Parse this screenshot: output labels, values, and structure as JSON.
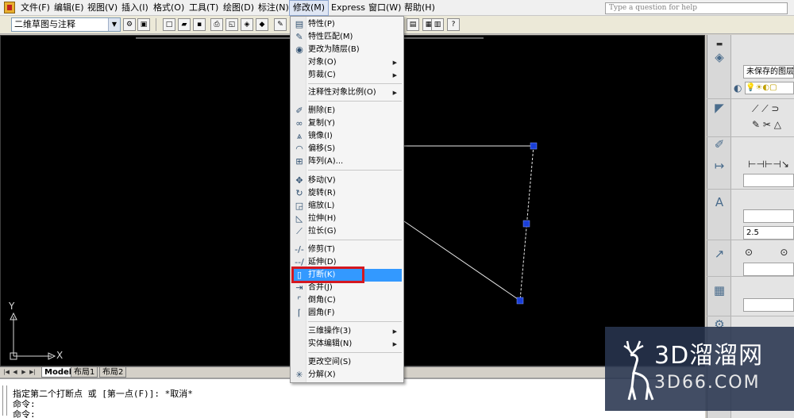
{
  "menubar": {
    "items": [
      {
        "label": "文件(F)"
      },
      {
        "label": "编辑(E)"
      },
      {
        "label": "视图(V)"
      },
      {
        "label": "插入(I)"
      },
      {
        "label": "格式(O)"
      },
      {
        "label": "工具(T)"
      },
      {
        "label": "绘图(D)"
      },
      {
        "label": "标注(N)"
      },
      {
        "label": "修改(M)"
      },
      {
        "label": "Express"
      },
      {
        "label": "窗口(W)"
      },
      {
        "label": "帮助(H)"
      }
    ],
    "active_menu": "修改(M)",
    "help_placeholder": "Type a question for help"
  },
  "toolbar": {
    "workspace": "二维草图与注释"
  },
  "modify_menu": {
    "items": [
      {
        "label": "特性(P)",
        "icon": "properties-icon"
      },
      {
        "label": "特性匹配(M)",
        "icon": "match-brush-icon"
      },
      {
        "label": "更改为随层(B)",
        "icon": "bylayer-icon"
      },
      {
        "label": "对象(O)",
        "submenu": true
      },
      {
        "label": "剪裁(C)",
        "submenu": true
      },
      {
        "label": "注释性对象比例(O)",
        "submenu": true
      },
      {
        "label": "删除(E)",
        "icon": "erase-icon"
      },
      {
        "label": "复制(Y)",
        "icon": "copy-icon"
      },
      {
        "label": "镜像(I)",
        "icon": "mirror-icon"
      },
      {
        "label": "偏移(S)",
        "icon": "offset-icon"
      },
      {
        "label": "阵列(A)...",
        "icon": "array-icon"
      },
      {
        "label": "移动(V)",
        "icon": "move-icon"
      },
      {
        "label": "旋转(R)",
        "icon": "rotate-icon"
      },
      {
        "label": "缩放(L)",
        "icon": "scale-icon"
      },
      {
        "label": "拉伸(H)",
        "icon": "stretch-icon"
      },
      {
        "label": "拉长(G)",
        "icon": "lengthen-icon"
      },
      {
        "label": "修剪(T)",
        "icon": "trim-icon"
      },
      {
        "label": "延伸(D)",
        "icon": "extend-icon"
      },
      {
        "label": "打断(K)",
        "icon": "break-icon",
        "highlighted": true
      },
      {
        "label": "合并(J)",
        "icon": "join-icon"
      },
      {
        "label": "倒角(C)",
        "icon": "chamfer-icon"
      },
      {
        "label": "圆角(F)",
        "icon": "fillet-icon"
      },
      {
        "label": "三维操作(3)",
        "submenu": true
      },
      {
        "label": "实体编辑(N)",
        "submenu": true
      },
      {
        "label": "更改空间(S)",
        "icon": "change-space-icon"
      },
      {
        "label": "分解(X)",
        "icon": "explode-icon"
      }
    ]
  },
  "canvas": {
    "ucs_x": "X",
    "ucs_y": "Y"
  },
  "tabs": [
    {
      "label": "Model",
      "active": true
    },
    {
      "label": "布局1",
      "active": false
    },
    {
      "label": "布局2",
      "active": false
    }
  ],
  "command": {
    "lines": [
      "指定第二个打断点 或 [第一点(F)]: *取消*",
      "命令:",
      "命令:"
    ]
  },
  "palette": {
    "layer_field": "未保存的图层状",
    "text_height": "2.5"
  },
  "watermark": {
    "title": "3D溜溜网",
    "url": "3D66.COM"
  },
  "colors": {
    "menu_highlight": "#3399ff",
    "annotation_box": "#d41820",
    "grip": "#1a3fd8",
    "canvas": "#000000"
  }
}
